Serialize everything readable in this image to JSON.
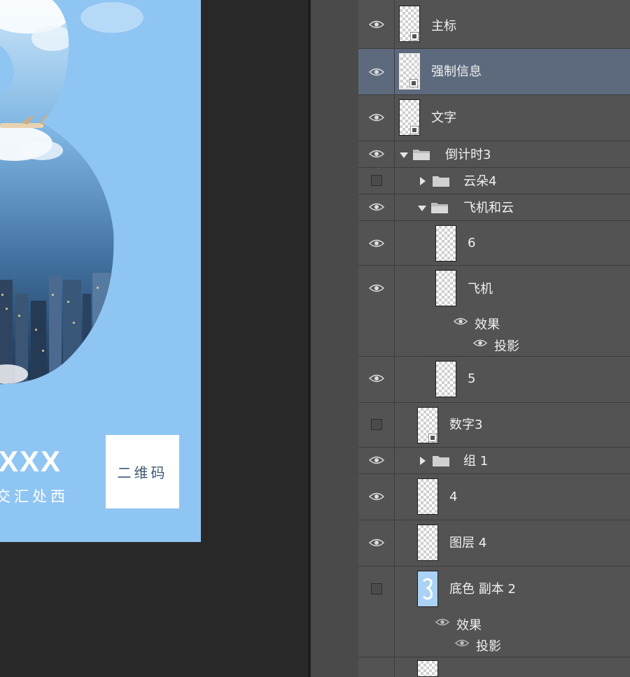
{
  "poster": {
    "headline": "XXX",
    "address": "交汇处西",
    "qr_label": "二维码"
  },
  "layers": [
    {
      "name": "主标",
      "visible": true
    },
    {
      "name": "强制信息",
      "visible": true,
      "selected": true
    },
    {
      "name": "文字",
      "visible": true
    },
    {
      "name": "倒计时3",
      "visible": true,
      "type": "group",
      "expanded": true
    },
    {
      "name": "云朵4",
      "visible": false,
      "type": "group",
      "expanded": false
    },
    {
      "name": "飞机和云",
      "visible": true,
      "type": "group",
      "expanded": true
    },
    {
      "name": "6",
      "visible": true
    },
    {
      "name": "飞机",
      "visible": true,
      "effects_label": "效果",
      "effects": [
        "投影"
      ]
    },
    {
      "name": "5",
      "visible": true
    },
    {
      "name": "数字3",
      "visible": false
    },
    {
      "name": "组 1",
      "visible": true,
      "type": "group",
      "expanded": false
    },
    {
      "name": "4",
      "visible": true
    },
    {
      "name": "图层 4",
      "visible": true
    },
    {
      "name": "底色 副本 2",
      "visible": false,
      "effects_label": "效果",
      "effects": [
        "投影"
      ]
    }
  ],
  "colors": {
    "poster_sky": "#8ec5f2",
    "panel_bg": "#535353",
    "selected_row": "#5d6a7d",
    "canvas_bg": "#282828"
  }
}
